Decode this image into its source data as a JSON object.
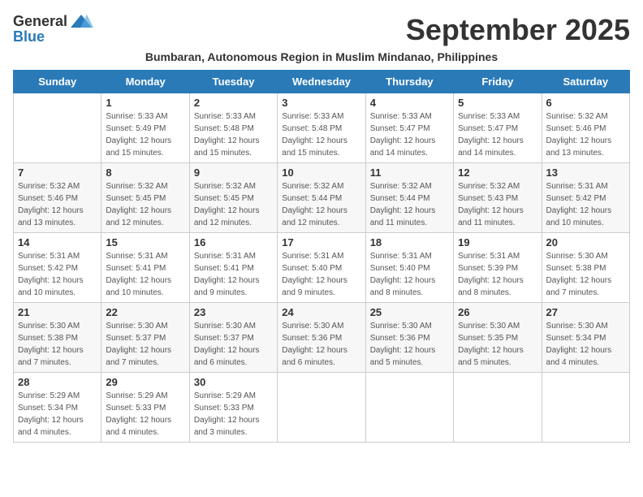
{
  "logo": {
    "general": "General",
    "blue": "Blue"
  },
  "title": "September 2025",
  "subtitle": "Bumbaran, Autonomous Region in Muslim Mindanao, Philippines",
  "days_of_week": [
    "Sunday",
    "Monday",
    "Tuesday",
    "Wednesday",
    "Thursday",
    "Friday",
    "Saturday"
  ],
  "weeks": [
    [
      {
        "day": "",
        "lines": []
      },
      {
        "day": "1",
        "lines": [
          "Sunrise: 5:33 AM",
          "Sunset: 5:49 PM",
          "Daylight: 12 hours",
          "and 15 minutes."
        ]
      },
      {
        "day": "2",
        "lines": [
          "Sunrise: 5:33 AM",
          "Sunset: 5:48 PM",
          "Daylight: 12 hours",
          "and 15 minutes."
        ]
      },
      {
        "day": "3",
        "lines": [
          "Sunrise: 5:33 AM",
          "Sunset: 5:48 PM",
          "Daylight: 12 hours",
          "and 15 minutes."
        ]
      },
      {
        "day": "4",
        "lines": [
          "Sunrise: 5:33 AM",
          "Sunset: 5:47 PM",
          "Daylight: 12 hours",
          "and 14 minutes."
        ]
      },
      {
        "day": "5",
        "lines": [
          "Sunrise: 5:33 AM",
          "Sunset: 5:47 PM",
          "Daylight: 12 hours",
          "and 14 minutes."
        ]
      },
      {
        "day": "6",
        "lines": [
          "Sunrise: 5:32 AM",
          "Sunset: 5:46 PM",
          "Daylight: 12 hours",
          "and 13 minutes."
        ]
      }
    ],
    [
      {
        "day": "7",
        "lines": [
          "Sunrise: 5:32 AM",
          "Sunset: 5:46 PM",
          "Daylight: 12 hours",
          "and 13 minutes."
        ]
      },
      {
        "day": "8",
        "lines": [
          "Sunrise: 5:32 AM",
          "Sunset: 5:45 PM",
          "Daylight: 12 hours",
          "and 12 minutes."
        ]
      },
      {
        "day": "9",
        "lines": [
          "Sunrise: 5:32 AM",
          "Sunset: 5:45 PM",
          "Daylight: 12 hours",
          "and 12 minutes."
        ]
      },
      {
        "day": "10",
        "lines": [
          "Sunrise: 5:32 AM",
          "Sunset: 5:44 PM",
          "Daylight: 12 hours",
          "and 12 minutes."
        ]
      },
      {
        "day": "11",
        "lines": [
          "Sunrise: 5:32 AM",
          "Sunset: 5:44 PM",
          "Daylight: 12 hours",
          "and 11 minutes."
        ]
      },
      {
        "day": "12",
        "lines": [
          "Sunrise: 5:32 AM",
          "Sunset: 5:43 PM",
          "Daylight: 12 hours",
          "and 11 minutes."
        ]
      },
      {
        "day": "13",
        "lines": [
          "Sunrise: 5:31 AM",
          "Sunset: 5:42 PM",
          "Daylight: 12 hours",
          "and 10 minutes."
        ]
      }
    ],
    [
      {
        "day": "14",
        "lines": [
          "Sunrise: 5:31 AM",
          "Sunset: 5:42 PM",
          "Daylight: 12 hours",
          "and 10 minutes."
        ]
      },
      {
        "day": "15",
        "lines": [
          "Sunrise: 5:31 AM",
          "Sunset: 5:41 PM",
          "Daylight: 12 hours",
          "and 10 minutes."
        ]
      },
      {
        "day": "16",
        "lines": [
          "Sunrise: 5:31 AM",
          "Sunset: 5:41 PM",
          "Daylight: 12 hours",
          "and 9 minutes."
        ]
      },
      {
        "day": "17",
        "lines": [
          "Sunrise: 5:31 AM",
          "Sunset: 5:40 PM",
          "Daylight: 12 hours",
          "and 9 minutes."
        ]
      },
      {
        "day": "18",
        "lines": [
          "Sunrise: 5:31 AM",
          "Sunset: 5:40 PM",
          "Daylight: 12 hours",
          "and 8 minutes."
        ]
      },
      {
        "day": "19",
        "lines": [
          "Sunrise: 5:31 AM",
          "Sunset: 5:39 PM",
          "Daylight: 12 hours",
          "and 8 minutes."
        ]
      },
      {
        "day": "20",
        "lines": [
          "Sunrise: 5:30 AM",
          "Sunset: 5:38 PM",
          "Daylight: 12 hours",
          "and 7 minutes."
        ]
      }
    ],
    [
      {
        "day": "21",
        "lines": [
          "Sunrise: 5:30 AM",
          "Sunset: 5:38 PM",
          "Daylight: 12 hours",
          "and 7 minutes."
        ]
      },
      {
        "day": "22",
        "lines": [
          "Sunrise: 5:30 AM",
          "Sunset: 5:37 PM",
          "Daylight: 12 hours",
          "and 7 minutes."
        ]
      },
      {
        "day": "23",
        "lines": [
          "Sunrise: 5:30 AM",
          "Sunset: 5:37 PM",
          "Daylight: 12 hours",
          "and 6 minutes."
        ]
      },
      {
        "day": "24",
        "lines": [
          "Sunrise: 5:30 AM",
          "Sunset: 5:36 PM",
          "Daylight: 12 hours",
          "and 6 minutes."
        ]
      },
      {
        "day": "25",
        "lines": [
          "Sunrise: 5:30 AM",
          "Sunset: 5:36 PM",
          "Daylight: 12 hours",
          "and 5 minutes."
        ]
      },
      {
        "day": "26",
        "lines": [
          "Sunrise: 5:30 AM",
          "Sunset: 5:35 PM",
          "Daylight: 12 hours",
          "and 5 minutes."
        ]
      },
      {
        "day": "27",
        "lines": [
          "Sunrise: 5:30 AM",
          "Sunset: 5:34 PM",
          "Daylight: 12 hours",
          "and 4 minutes."
        ]
      }
    ],
    [
      {
        "day": "28",
        "lines": [
          "Sunrise: 5:29 AM",
          "Sunset: 5:34 PM",
          "Daylight: 12 hours",
          "and 4 minutes."
        ]
      },
      {
        "day": "29",
        "lines": [
          "Sunrise: 5:29 AM",
          "Sunset: 5:33 PM",
          "Daylight: 12 hours",
          "and 4 minutes."
        ]
      },
      {
        "day": "30",
        "lines": [
          "Sunrise: 5:29 AM",
          "Sunset: 5:33 PM",
          "Daylight: 12 hours",
          "and 3 minutes."
        ]
      },
      {
        "day": "",
        "lines": []
      },
      {
        "day": "",
        "lines": []
      },
      {
        "day": "",
        "lines": []
      },
      {
        "day": "",
        "lines": []
      }
    ]
  ]
}
